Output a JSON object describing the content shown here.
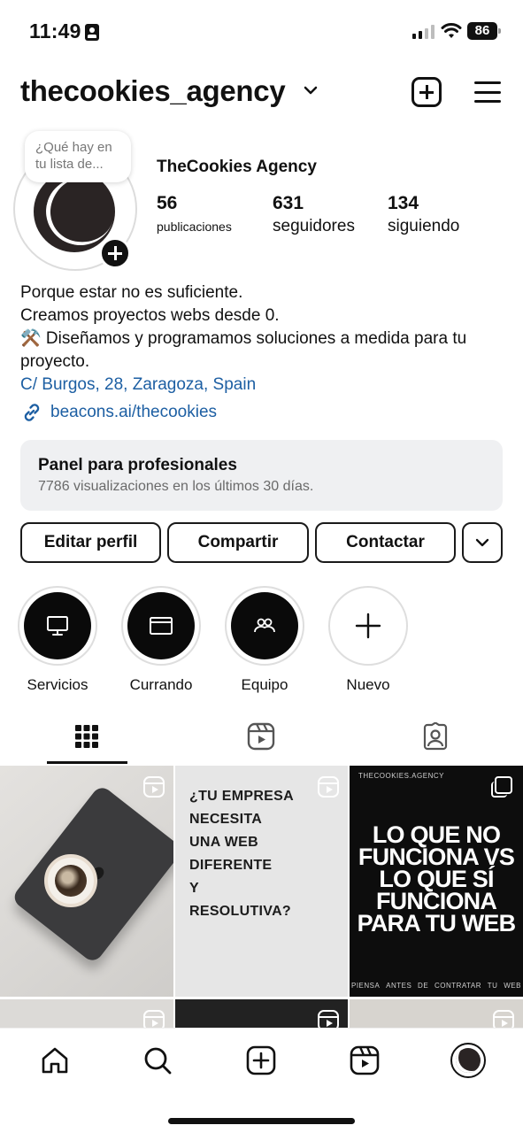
{
  "status_bar": {
    "time": "11:49",
    "battery": "86"
  },
  "header": {
    "username": "thecookies_agency",
    "icons": [
      "chevron-down-icon",
      "create-post-icon",
      "menu-icon"
    ]
  },
  "profile": {
    "note_text": "¿Qué hay en tu lista de...",
    "display_name": "TheCookies Agency",
    "stats": {
      "posts": {
        "value": "56",
        "label": "publicaciones"
      },
      "followers": {
        "value": "631",
        "label": "seguidores"
      },
      "following": {
        "value": "134",
        "label": "siguiendo"
      }
    },
    "bio": {
      "line1": "Porque estar no es suficiente.",
      "line2": "Creamos proyectos webs desde 0.",
      "line3": "⚒️ Diseñamos y programamos soluciones a medida para tu proyecto.",
      "address": "C/ Burgos, 28, Zaragoza, Spain",
      "link": "beacons.ai/thecookies"
    }
  },
  "pro_panel": {
    "title": "Panel para profesionales",
    "subtitle": "7786 visualizaciones en los últimos 30 días."
  },
  "actions": {
    "edit": "Editar perfil",
    "share": "Compartir",
    "contact": "Contactar"
  },
  "highlights": [
    {
      "label": "Servicios",
      "icon": "monitor-icon"
    },
    {
      "label": "Currando",
      "icon": "window-icon"
    },
    {
      "label": "Equipo",
      "icon": "group-icon"
    },
    {
      "label": "Nuevo",
      "icon": "plus-icon"
    }
  ],
  "tabs": [
    "grid-icon",
    "reels-icon",
    "tagged-icon"
  ],
  "posts": {
    "post2_lines": [
      "¿TU EMPRESA",
      "NECESITA",
      "UNA WEB",
      "DIFERENTE",
      "Y",
      "RESOLUTIVA?"
    ],
    "post3_brand": "THECOOKIES.AGENCY",
    "post3_title": "LO QUE NO FUNCIONA VS LO QUE SÍ FUNCIONA PARA TU WEB",
    "post3_footer": [
      "PIENSA",
      "ANTES",
      "DE",
      "CONTRATAR",
      "TU",
      "WEB"
    ]
  },
  "bottom_nav": [
    "home-icon",
    "search-icon",
    "create-icon",
    "reels-icon",
    "profile-avatar"
  ],
  "colors": {
    "link": "#1d5fa3",
    "panel_bg": "#eff0f2"
  }
}
